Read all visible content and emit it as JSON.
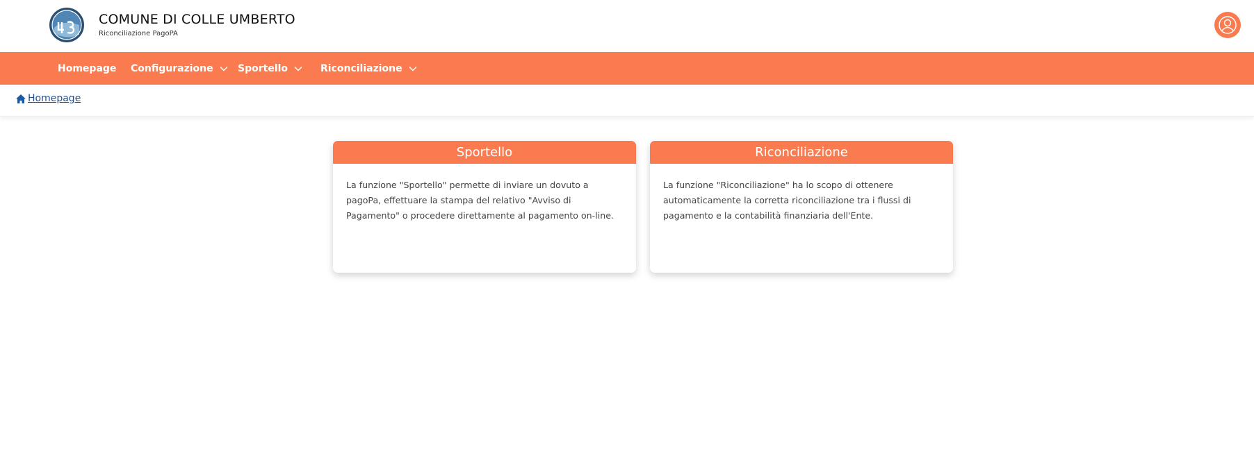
{
  "header": {
    "logo_icon": "municipal-emblem-icon",
    "title": "COMUNE DI COLLE UMBERTO",
    "subtitle": "Riconciliazione PagoPA",
    "user_icon": "user-account-icon"
  },
  "nav": {
    "items": [
      {
        "label": "Homepage",
        "dropdown": false
      },
      {
        "label": "Configurazione",
        "dropdown": true
      },
      {
        "label": "Sportello",
        "dropdown": true
      },
      {
        "label": "Riconciliazione",
        "dropdown": true
      }
    ]
  },
  "breadcrumb": {
    "icon": "home-icon",
    "label": "Homepage"
  },
  "cards": [
    {
      "title": "Sportello",
      "text": "La funzione \"Sportello\" permette di inviare un dovuto a pagoPa, effettuare la stampa del relativo \"Avviso di Pagamento\" o procedere direttamente al pagamento on-line."
    },
    {
      "title": "Riconciliazione",
      "text": "La funzione \"Riconciliazione\" ha lo scopo di ottenere automaticamente la corretta riconciliazione tra i flussi di pagamento e la contabilità finanziaria dell'Ente."
    }
  ],
  "colors": {
    "accent": "#f97b4f",
    "link": "#1f4f8f"
  }
}
